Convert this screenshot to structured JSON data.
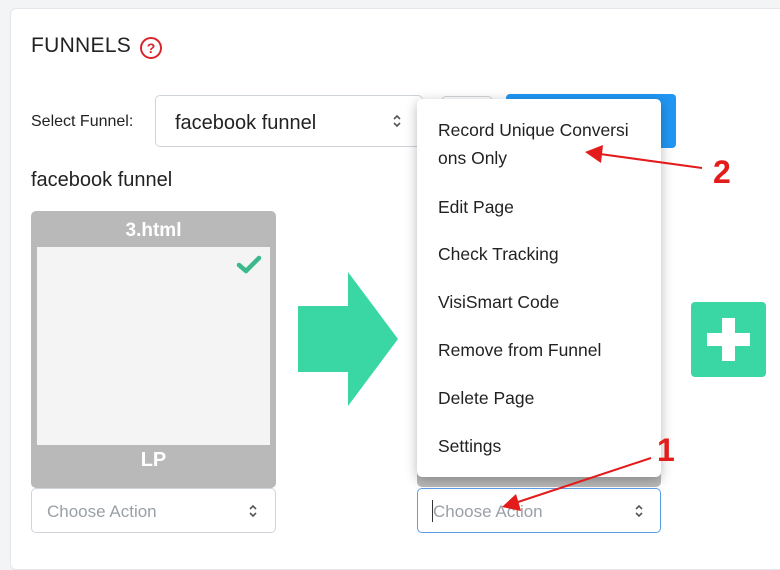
{
  "header": {
    "title": "FUNNELS",
    "help_icon": "question-circle-icon"
  },
  "selector": {
    "label": "Select Funnel:",
    "value": "facebook funnel"
  },
  "funnel": {
    "name": "facebook funnel"
  },
  "pages": [
    {
      "filename": "3.html",
      "type": "LP",
      "checked": true,
      "action_placeholder": "Choose Action"
    },
    {
      "action_placeholder": "Choose Action"
    }
  ],
  "dropdown_menu": {
    "items": [
      {
        "label_line1": "Record Unique Conversi",
        "label_line2": "ons Only"
      },
      {
        "label": "Edit Page"
      },
      {
        "label": "Check Tracking"
      },
      {
        "label": "VisiSmart Code"
      },
      {
        "label": "Remove from Funnel"
      },
      {
        "label": "Delete Page"
      },
      {
        "label": "Settings"
      }
    ]
  },
  "annotations": {
    "marker_1": "1",
    "marker_2": "2"
  },
  "colors": {
    "accent_green": "#3ad6a4",
    "primary_blue": "#2196f3",
    "annotation_red": "#e31b1b",
    "help_red": "#d9262c"
  }
}
